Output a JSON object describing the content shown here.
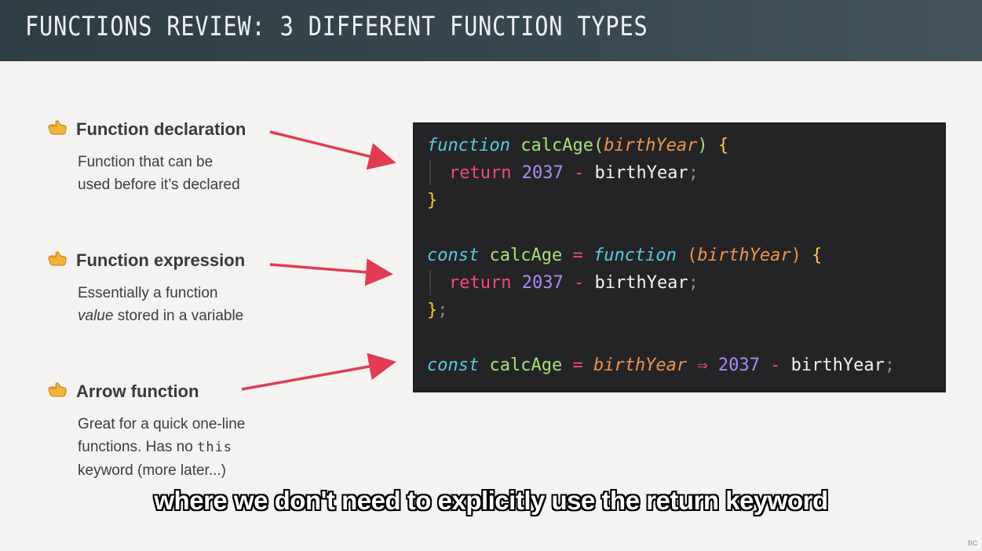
{
  "header": {
    "title": "FUNCTIONS REVIEW: 3 DIFFERENT FUNCTION TYPES"
  },
  "items": [
    {
      "title": "Function declaration",
      "desc_line1": "Function that can be",
      "desc_line2": "used before it’s declared",
      "icon": "pointing-hand-icon"
    },
    {
      "title": "Function expression",
      "desc_line1": "Essentially a function",
      "desc_line2_em": "value",
      "desc_line2_rest": " stored in a variable",
      "icon": "pointing-hand-icon"
    },
    {
      "title": "Arrow function",
      "desc_line1": "Great for a quick one-line",
      "desc_line2_pre": "functions. Has no ",
      "desc_line2_code": "this",
      "desc_line3": "keyword (more later...)",
      "icon": "pointing-hand-icon"
    }
  ],
  "code": {
    "decl": {
      "kw": "function",
      "name": "calcAge",
      "paren_open": "(",
      "param": "birthYear",
      "paren_close": ")",
      "brace_open": "{",
      "ret": "return",
      "num": "2037",
      "op": "-",
      "ident": "birthYear",
      "semi": ";",
      "brace_close": "}"
    },
    "expr": {
      "kw_const": "const",
      "name": "calcAge",
      "eq": "=",
      "kw_fn": "function",
      "paren_open": "(",
      "param": "birthYear",
      "paren_close": ")",
      "brace_open": "{",
      "ret": "return",
      "num": "2037",
      "op": "-",
      "ident": "birthYear",
      "semi": ";",
      "brace_close": "}",
      "semi_end": ";"
    },
    "arrow": {
      "kw_const": "const",
      "name": "calcAge",
      "eq": "=",
      "param": "birthYear",
      "arrow": "⇒",
      "num": "2037",
      "op": "-",
      "ident": "birthYear",
      "semi": ";"
    }
  },
  "subtitle": "where we don't need to explicitly use the return keyword",
  "logo": "вс"
}
